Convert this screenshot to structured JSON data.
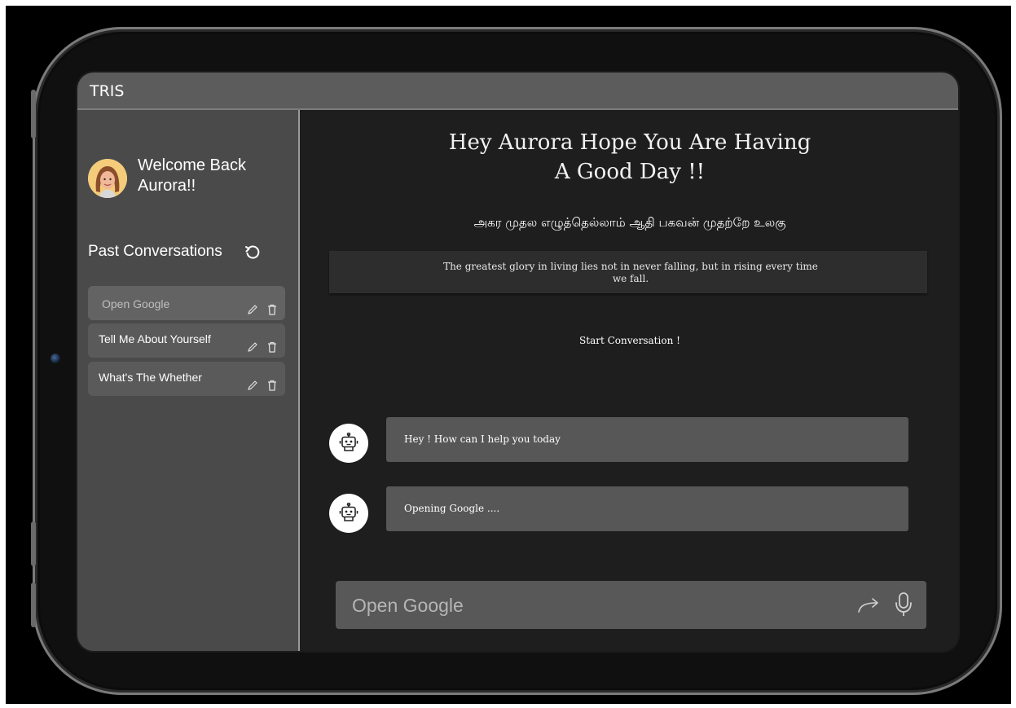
{
  "app": {
    "title": "TRIS"
  },
  "sidebar": {
    "welcome": "Welcome Back Aurora!!",
    "past_title": "Past Conversations",
    "conversations": [
      {
        "label": "Open Google",
        "active": true
      },
      {
        "label": "Tell Me About Yourself",
        "active": false
      },
      {
        "label": "What's The Whether",
        "active": false
      }
    ]
  },
  "main": {
    "greeting": "Hey Aurora Hope You Are Having\nA Good Day !!",
    "tamil_line": "அகர முதல எழுத்தெல்லாம் ஆதி பகவன் முதற்றே உலகு",
    "quote": "The greatest glory in living lies not in never falling, but in rising every time we fall.",
    "start_label": "Start Conversation !",
    "messages": [
      {
        "text": "Hey ! How can I help you today"
      },
      {
        "text": "Opening Google ...."
      }
    ],
    "input": {
      "value": "Open Google",
      "placeholder": "Open Google"
    }
  },
  "icons": {
    "refresh": "refresh-icon",
    "edit": "pencil-icon",
    "delete": "trash-icon",
    "bot": "robot-icon",
    "send": "arrow-right-icon",
    "mic": "microphone-icon"
  },
  "colors": {
    "background": "#1e1e1e",
    "sidebar": "#4a4a4a",
    "topbar": "#5c5c5c",
    "message_bubble": "#575757",
    "input": "#585858"
  }
}
